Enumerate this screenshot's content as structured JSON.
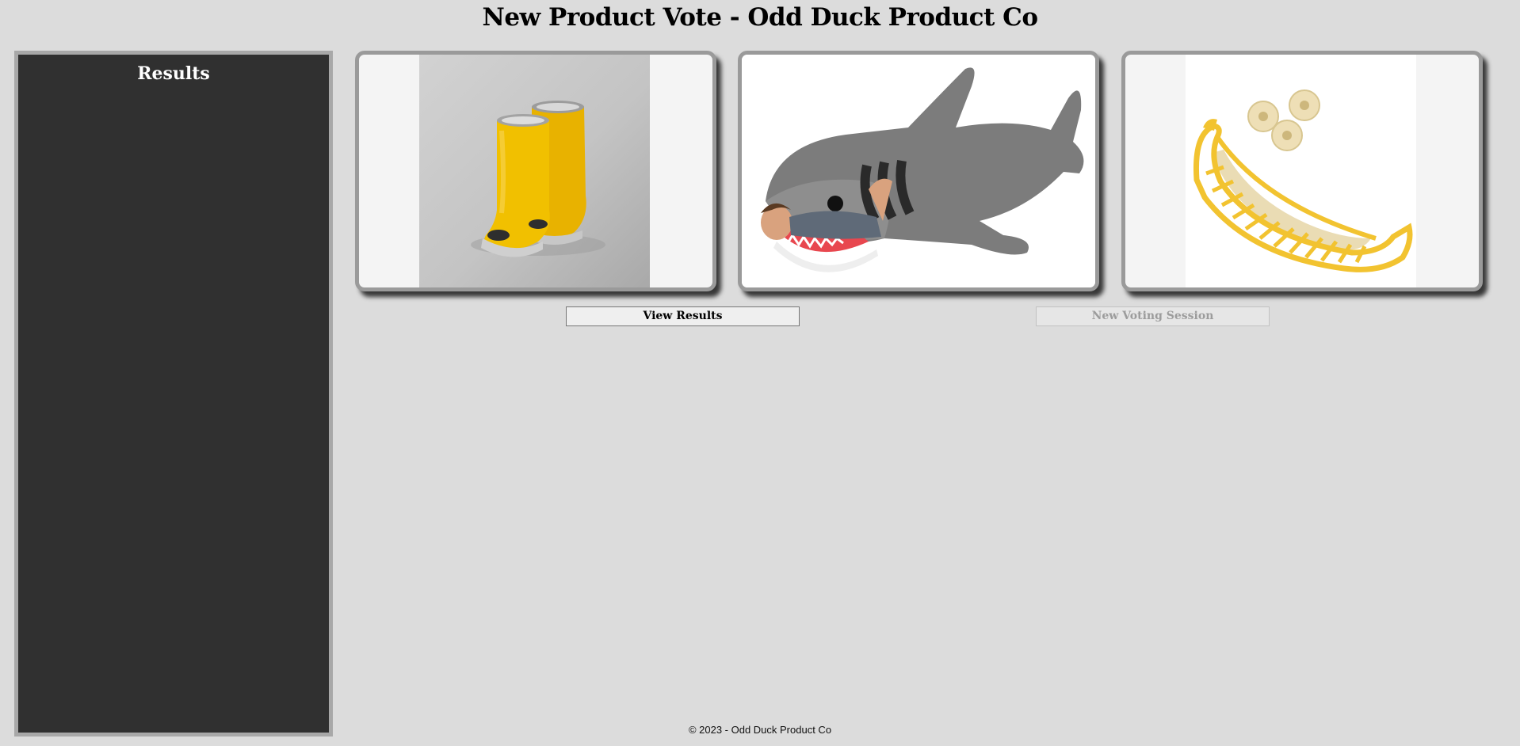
{
  "header": {
    "title": "New Product Vote - Odd Duck Product Co"
  },
  "results_panel": {
    "heading": "Results"
  },
  "products": [
    {
      "icon": "rain-boots-image"
    },
    {
      "icon": "shark-sleeping-bag-image"
    },
    {
      "icon": "banana-slicer-image"
    }
  ],
  "buttons": {
    "view_results": "View Results",
    "new_voting_session": "New Voting Session"
  },
  "footer": {
    "text": "© 2023 - Odd Duck Product Co"
  },
  "colors": {
    "background": "#dcdcdc",
    "panel": "#303030",
    "panel_border": "#a8a8a8"
  }
}
